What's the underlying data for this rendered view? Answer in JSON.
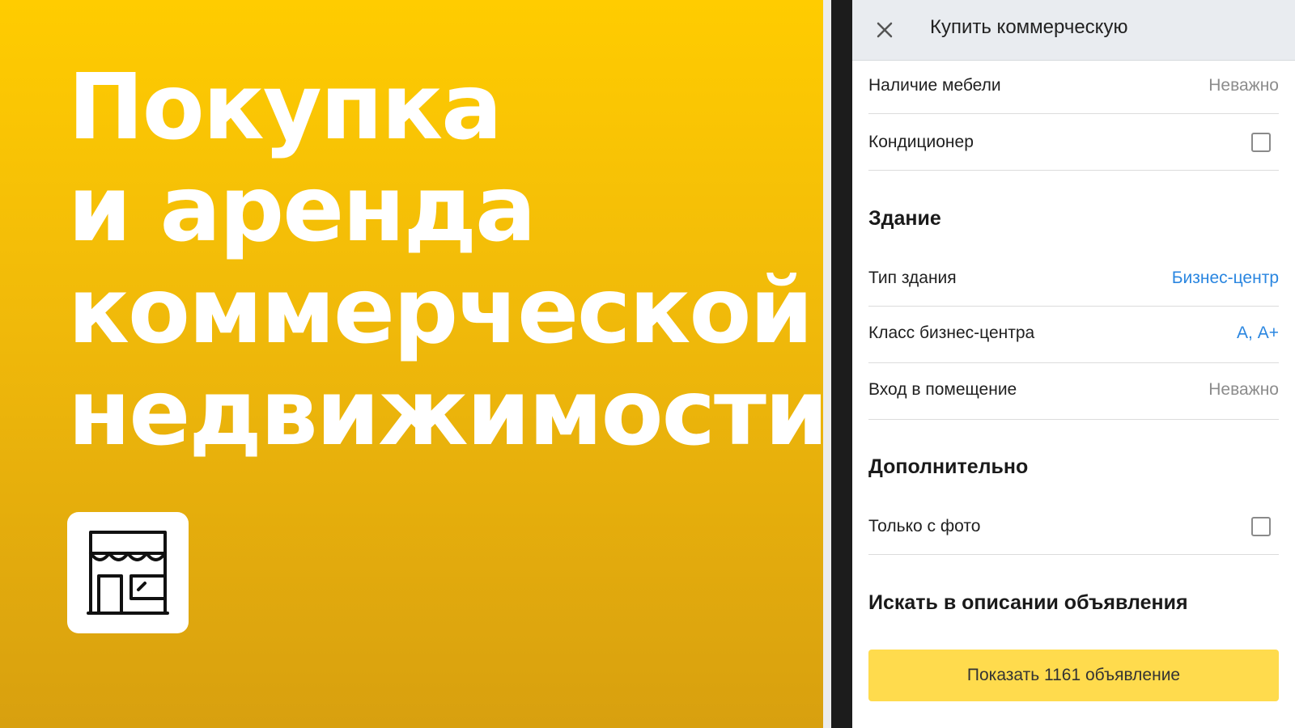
{
  "promo": {
    "title_lines": [
      "Покупка",
      "и аренда",
      "коммерческой",
      "недвижимости"
    ],
    "icon": "storefront-icon"
  },
  "screen": {
    "topbar": {
      "close_icon": "close-icon",
      "title": "Купить коммерческую"
    },
    "rows": {
      "furniture": {
        "label": "Наличие мебели",
        "value": "Неважно"
      },
      "aircon": {
        "label": "Кондиционер",
        "checked": false
      },
      "building_type": {
        "label": "Тип здания",
        "value": "Бизнес-центр"
      },
      "bc_class": {
        "label": "Класс бизнес-центра",
        "value": "А, А+"
      },
      "entrance": {
        "label": "Вход в помещение",
        "value": "Неважно"
      },
      "photo_only": {
        "label": "Только с фото",
        "checked": false
      }
    },
    "sections": {
      "building": "Здание",
      "additional": "Дополнительно",
      "search_desc": "Искать в описании объявления"
    },
    "cta_label": "Показать 1161 объявление"
  },
  "colors": {
    "brand_yellow": "#ffcc00",
    "cta_yellow": "#ffdb4d",
    "link_blue": "#2a86e0"
  }
}
